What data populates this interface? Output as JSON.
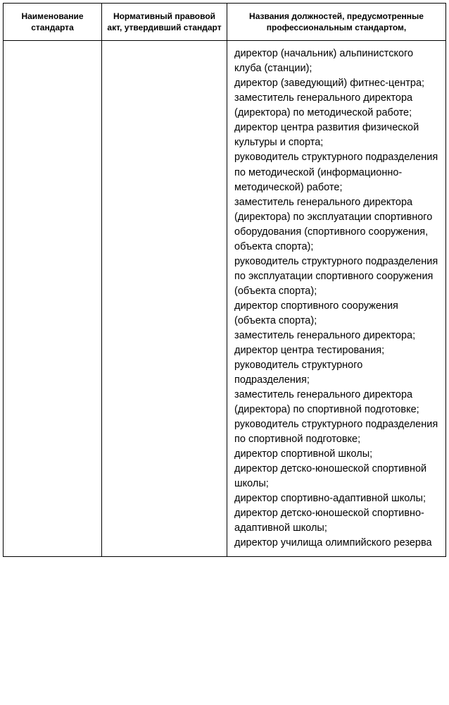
{
  "table": {
    "headers": {
      "col1": "Наименование стандарта",
      "col2": "Нормативный правовой акт, утвердивший стандарт",
      "col3": "Названия должностей, предусмотренные профессиональным стандартом,"
    },
    "row": {
      "col1": "",
      "col2": "",
      "col3": "директор (начальник) альпинистского клуба (станции);\nдиректор (заведующий) фитнес-центра;\nзаместитель генерального директора (директора) по методической работе;\nдиректор центра развития физической культуры и спорта;\nруководитель структурного подразделения по методической (информационно-методической) работе;\nзаместитель генерального директора (директора) по эксплуатации спортивного оборудования (спортивного сооружения, объекта спорта);\nруководитель структурного подразделения по эксплуатации спортивного сооружения (объекта спорта);\nдиректор спортивного сооружения (объекта спорта);\nзаместитель генерального директора;\nдиректор центра тестирования;\nруководитель структурного подразделения;\nзаместитель генерального директора (директора) по спортивной подготовке;\nруководитель структурного подразделения по спортивной подготовке;\nдиректор спортивной школы;\nдиректор детско-юношеской спортивной школы;\nдиректор спортивно-адаптивной школы;\nдиректор детско-юношеской спортивно-адаптивной школы;\nдиректор училища олимпийского резерва"
    }
  }
}
